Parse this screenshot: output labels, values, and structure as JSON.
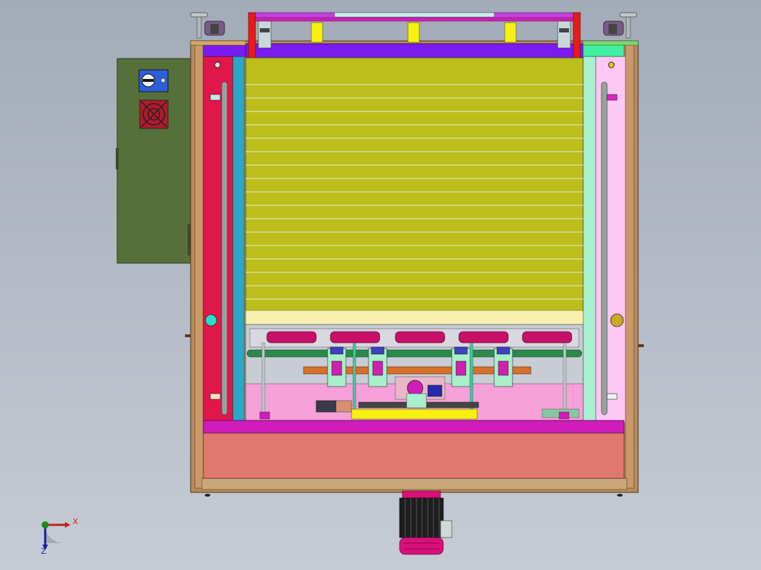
{
  "viewport": {
    "background_top": "#a3abb8",
    "background_bottom": "#c6ccd5"
  },
  "triad": {
    "x_label": "X",
    "z_label": "Z",
    "x_color": "#cc1a1a",
    "y_color": "#1a8c1a",
    "z_color": "#1a1aa8"
  },
  "colors": {
    "frame_red": "#e0174a",
    "frame_wood": "#b88a5c",
    "chamber_yellow": "#bdbd1c",
    "control_box_green": "#56703a",
    "top_bar_purple": "#7a1cf0",
    "bottom_pink": "#e07870",
    "inner_pink": "#f5a0d8",
    "side_cyan": "#2aa8c8",
    "side_mint": "#a8f0d0",
    "magenta_rail": "#d01cb8",
    "motor_black": "#1e1e1e",
    "motor_magenta": "#d8107a"
  }
}
